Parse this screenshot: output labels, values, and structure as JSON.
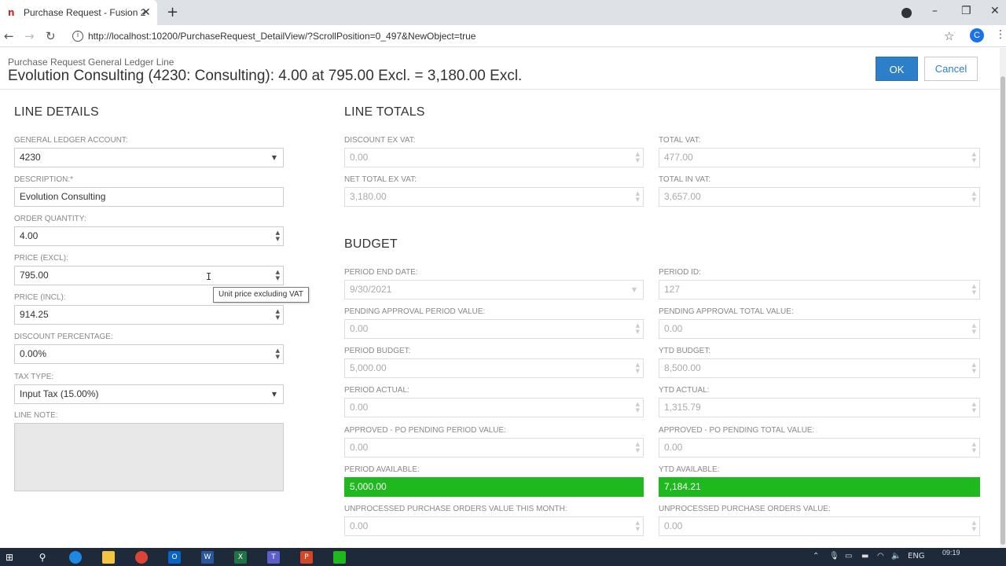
{
  "browser": {
    "tab_title": "Purchase Request - Fusion 2",
    "tab_favicon": "n",
    "url": "http://localhost:10200/PurchaseRequest_DetailView/?ScrollPosition=0_497&NewObject=true",
    "profile_initial": "C"
  },
  "header": {
    "subtitle": "Purchase Request General Ledger Line",
    "title": "Evolution Consulting (4230: Consulting): 4.00 at 795.00 Excl. = 3,180.00 Excl.",
    "ok_label": "OK",
    "cancel_label": "Cancel"
  },
  "line_details": {
    "title": "LINE DETAILS",
    "gl_account_label": "GENERAL LEDGER ACCOUNT:",
    "gl_account_value": "4230",
    "description_label": "DESCRIPTION:*",
    "description_value": "Evolution Consulting",
    "quantity_label": "ORDER QUANTITY:",
    "quantity_value": "4.00",
    "price_excl_label": "PRICE (EXCL):",
    "price_excl_value": "795.00",
    "price_excl_tooltip": "Unit price excluding VAT",
    "price_incl_label": "PRICE (INCL):",
    "price_incl_value": "914.25",
    "discount_label": "DISCOUNT PERCENTAGE:",
    "discount_value": "0.00%",
    "tax_type_label": "TAX TYPE:",
    "tax_type_value": "Input Tax (15.00%)",
    "line_note_label": "LINE NOTE:"
  },
  "line_totals": {
    "title": "LINE TOTALS",
    "discount_ex_vat_label": "DISCOUNT EX VAT:",
    "discount_ex_vat_value": "0.00",
    "total_vat_label": "TOTAL VAT:",
    "total_vat_value": "477.00",
    "net_total_label": "NET TOTAL EX VAT:",
    "net_total_value": "3,180.00",
    "total_in_vat_label": "TOTAL IN VAT:",
    "total_in_vat_value": "3,657.00"
  },
  "budget": {
    "title": "BUDGET",
    "period_end_label": "PERIOD END DATE:",
    "period_end_value": "9/30/2021",
    "period_id_label": "PERIOD ID:",
    "period_id_value": "127",
    "pending_period_label": "PENDING APPROVAL PERIOD VALUE:",
    "pending_period_value": "0.00",
    "pending_total_label": "PENDING APPROVAL TOTAL VALUE:",
    "pending_total_value": "0.00",
    "period_budget_label": "PERIOD BUDGET:",
    "period_budget_value": "5,000.00",
    "ytd_budget_label": "YTD BUDGET:",
    "ytd_budget_value": "8,500.00",
    "period_actual_label": "PERIOD ACTUAL:",
    "period_actual_value": "0.00",
    "ytd_actual_label": "YTD ACTUAL:",
    "ytd_actual_value": "1,315.79",
    "approved_period_label": "APPROVED - PO PENDING PERIOD VALUE:",
    "approved_period_value": "0.00",
    "approved_total_label": "APPROVED - PO PENDING TOTAL VALUE:",
    "approved_total_value": "0.00",
    "period_available_label": "PERIOD AVAILABLE:",
    "period_available_value": "5,000.00",
    "ytd_available_label": "YTD AVAILABLE:",
    "ytd_available_value": "7,184.21",
    "unprocessed_month_label": "UNPROCESSED PURCHASE ORDERS VALUE THIS MONTH:",
    "unprocessed_month_value": "0.00",
    "unprocessed_total_label": "UNPROCESSED PURCHASE ORDERS VALUE:",
    "unprocessed_total_value": "0.00"
  },
  "taskbar": {
    "language": "ENG",
    "time": "09:19"
  },
  "colors": {
    "accent": "#2d7fc9",
    "available_green": "#1fb91f"
  }
}
